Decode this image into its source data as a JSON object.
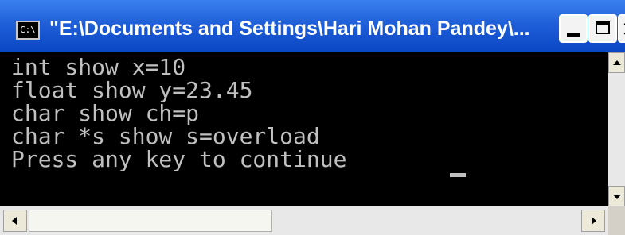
{
  "window": {
    "title": "\"E:\\Documents and Settings\\Hari Mohan Pandey\\...",
    "icon_name": "console-icon"
  },
  "console": {
    "lines": [
      "int show x=10",
      "float show y=23.45",
      "char show ch=p",
      "char *s show s=overload",
      "Press any key to continue"
    ]
  },
  "colors": {
    "titlebar": "#0a46c4",
    "console_background": "#000000",
    "console_text": "#c0c0c0"
  }
}
